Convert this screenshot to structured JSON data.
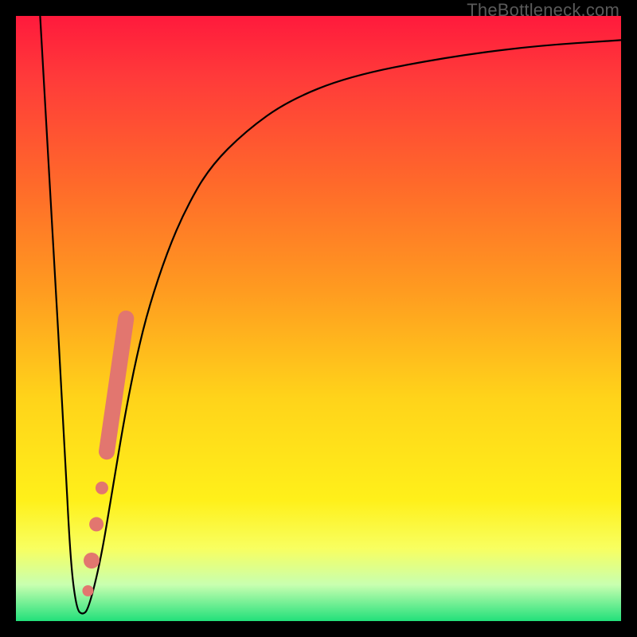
{
  "watermark": "TheBottleneck.com",
  "chart_data": {
    "type": "line",
    "title": "",
    "xlabel": "",
    "ylabel": "",
    "xlim": [
      0,
      100
    ],
    "ylim": [
      0,
      100
    ],
    "grid": false,
    "series": [
      {
        "name": "bottleneck-curve",
        "x": [
          4,
          6,
          8,
          9,
          10,
          11,
          12,
          14,
          16,
          18,
          20,
          22,
          25,
          28,
          32,
          38,
          45,
          55,
          70,
          85,
          100
        ],
        "y": [
          100,
          65,
          30,
          10,
          2,
          1,
          2,
          10,
          22,
          34,
          44,
          52,
          61,
          68,
          75,
          81,
          86,
          90,
          93,
          95,
          96
        ]
      }
    ],
    "markers": [
      {
        "name": "marker-segment",
        "x1": 15.0,
        "y1": 28,
        "x2": 18.2,
        "y2": 50,
        "r": 10
      },
      {
        "name": "marker-dot-1",
        "x": 14.2,
        "y": 22,
        "r": 8
      },
      {
        "name": "marker-dot-2",
        "x": 13.3,
        "y": 16,
        "r": 9
      },
      {
        "name": "marker-dot-3",
        "x": 12.5,
        "y": 10,
        "r": 10
      },
      {
        "name": "marker-dot-4",
        "x": 11.9,
        "y": 5,
        "r": 7
      }
    ],
    "colors": {
      "curve": "#000000",
      "marker": "#e2766f",
      "gradient_top": "#ff1a3c",
      "gradient_mid": "#ffd31a",
      "gradient_bottom": "#22e07a"
    }
  }
}
